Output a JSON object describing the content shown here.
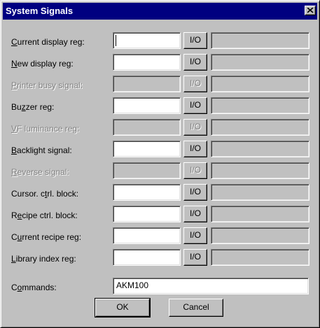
{
  "window": {
    "title": "System Signals",
    "close_label": "×"
  },
  "io_label": "I/O",
  "rows": [
    {
      "pre": "",
      "key": "C",
      "post": "urrent display reg:",
      "value": "",
      "enabled": true
    },
    {
      "pre": "",
      "key": "N",
      "post": "ew display reg:",
      "value": "",
      "enabled": true
    },
    {
      "pre": "",
      "key": "P",
      "post": "rinter busy signal:",
      "value": "",
      "enabled": false
    },
    {
      "pre": "Bu",
      "key": "z",
      "post": "zer reg:",
      "value": "",
      "enabled": true
    },
    {
      "pre": "",
      "key": "V",
      "post": "F luminance reg:",
      "value": "",
      "enabled": false
    },
    {
      "pre": "",
      "key": "B",
      "post": "acklight signal:",
      "value": "",
      "enabled": true
    },
    {
      "pre": "",
      "key": "R",
      "post": "everse signal:",
      "value": "",
      "enabled": false
    },
    {
      "pre": "Cursor. c",
      "key": "t",
      "post": "rl. block:",
      "value": "",
      "enabled": true
    },
    {
      "pre": "R",
      "key": "e",
      "post": "cipe ctrl. block:",
      "value": "",
      "enabled": true
    },
    {
      "pre": "C",
      "key": "u",
      "post": "rrent recipe reg:",
      "value": "",
      "enabled": true
    },
    {
      "pre": "",
      "key": "L",
      "post": "ibrary index reg:",
      "value": "",
      "enabled": true
    }
  ],
  "commands": {
    "pre": "C",
    "key": "o",
    "post": "mmands:",
    "value": "AKM100"
  },
  "buttons": {
    "ok": "OK",
    "cancel": "Cancel"
  }
}
